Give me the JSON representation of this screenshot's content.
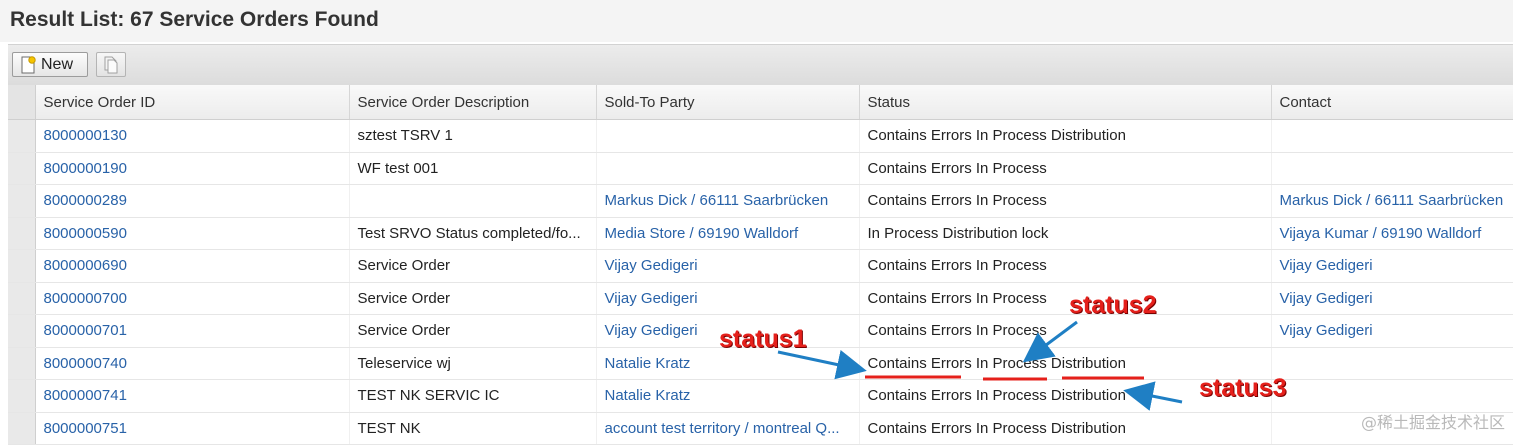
{
  "title": "Result List: 67 Service Orders Found",
  "toolbar": {
    "new_label": "New"
  },
  "columns": [
    "Service Order ID",
    "Service Order Description",
    "Sold-To Party",
    "Status",
    "Contact"
  ],
  "rows": [
    {
      "id": "8000000130",
      "description": "sztest TSRV 1",
      "sold_to": "",
      "status": "Contains Errors In Process Distribution",
      "contact": ""
    },
    {
      "id": "8000000190",
      "description": "WF test 001",
      "sold_to": "",
      "status": "Contains Errors In Process",
      "contact": ""
    },
    {
      "id": "8000000289",
      "description": "",
      "sold_to": "Markus Dick / 66111 Saarbrücken",
      "status": "Contains Errors In Process",
      "contact": "Markus Dick / 66111 Saarbrücken"
    },
    {
      "id": "8000000590",
      "description": "Test SRVO Status completed/fo...",
      "sold_to": "Media Store / 69190 Walldorf",
      "status": "In Process Distribution lock",
      "contact": "Vijaya Kumar / 69190 Walldorf"
    },
    {
      "id": "8000000690",
      "description": "Service Order",
      "sold_to": "Vijay Gedigeri",
      "status": "Contains Errors In Process",
      "contact": "Vijay Gedigeri"
    },
    {
      "id": "8000000700",
      "description": "Service Order",
      "sold_to": "Vijay Gedigeri",
      "status": "Contains Errors In Process",
      "contact": "Vijay Gedigeri"
    },
    {
      "id": "8000000701",
      "description": "Service Order",
      "sold_to": "Vijay Gedigeri",
      "status": "Contains Errors In Process",
      "contact": "Vijay Gedigeri"
    },
    {
      "id": "8000000740",
      "description": "Teleservice wj",
      "sold_to": "Natalie Kratz",
      "status": "Contains Errors In Process Distribution",
      "contact": ""
    },
    {
      "id": "8000000741",
      "description": "TEST NK SERVIC IC",
      "sold_to": "Natalie Kratz",
      "status": "Contains Errors In Process Distribution",
      "contact": ""
    },
    {
      "id": "8000000751",
      "description": "TEST NK",
      "sold_to": "account test territory / montreal Q...",
      "status": "Contains Errors In Process Distribution",
      "contact": ""
    }
  ],
  "annotations": {
    "status1": "status1",
    "status2": "status2",
    "status3": "status3"
  },
  "watermark": "@稀土掘金技术社区",
  "colors": {
    "link": "#2862a8",
    "annotation": "#e5201b",
    "arrow": "#1f7fc4"
  }
}
